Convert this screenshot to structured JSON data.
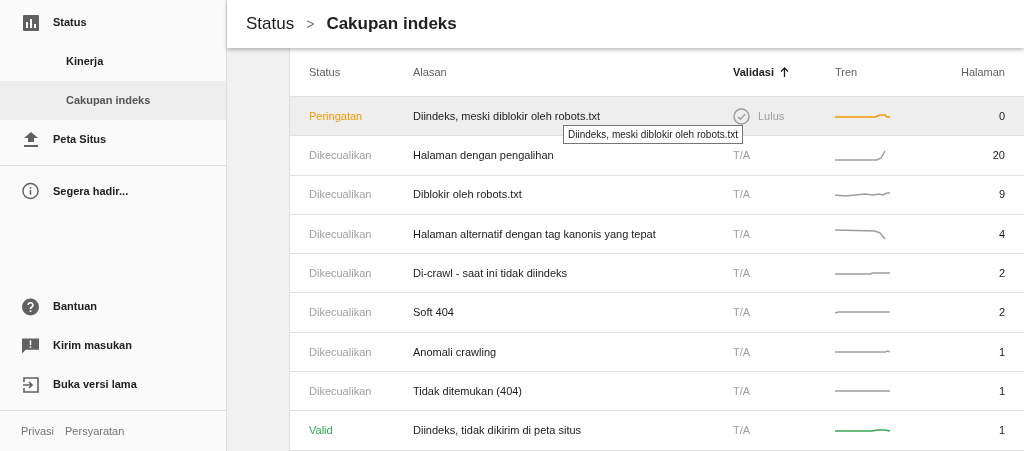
{
  "sidebar": {
    "items": [
      {
        "label": "Status",
        "selected": false,
        "children": [
          {
            "label": "Kinerja",
            "selected": false
          },
          {
            "label": "Cakupan indeks",
            "selected": true
          }
        ]
      },
      {
        "label": "Peta Situs",
        "selected": false
      }
    ],
    "soon": {
      "label": "Segera hadir..."
    },
    "bottom_items": [
      {
        "label": "Bantuan"
      },
      {
        "label": "Kirim masukan"
      },
      {
        "label": "Buka versi lama"
      }
    ],
    "footer_links": [
      "Privasi",
      "Persyaratan"
    ]
  },
  "breadcrumb": {
    "parent": "Status",
    "separator": ">",
    "current": "Cakupan indeks"
  },
  "table": {
    "columns": [
      {
        "label": "Status",
        "sorted": false
      },
      {
        "label": "Alasan",
        "sorted": false
      },
      {
        "label": "Validasi",
        "sorted": true
      },
      {
        "label": "Tren",
        "sorted": false
      },
      {
        "label": "Halaman",
        "sorted": false
      }
    ],
    "rows": [
      {
        "status": "Peringatan",
        "kind": "warning",
        "reason": "Diindeks, meski diblokir oleh robots.txt",
        "validation": "Lulus",
        "passed": true,
        "pages": "0",
        "selected": true
      },
      {
        "status": "Dikecualikan",
        "kind": "excluded",
        "reason": "Halaman dengan pengalihan",
        "validation": "T/A",
        "passed": false,
        "pages": "20",
        "selected": false
      },
      {
        "status": "Dikecualikan",
        "kind": "excluded",
        "reason": "Diblokir oleh robots.txt",
        "validation": "T/A",
        "passed": false,
        "pages": "9",
        "selected": false
      },
      {
        "status": "Dikecualikan",
        "kind": "excluded",
        "reason": "Halaman alternatif dengan tag kanonis yang tepat",
        "validation": "T/A",
        "passed": false,
        "pages": "4",
        "selected": false
      },
      {
        "status": "Dikecualikan",
        "kind": "excluded",
        "reason": "Di-crawl - saat ini tidak diindeks",
        "validation": "T/A",
        "passed": false,
        "pages": "2",
        "selected": false
      },
      {
        "status": "Dikecualikan",
        "kind": "excluded",
        "reason": "Soft 404",
        "validation": "T/A",
        "passed": false,
        "pages": "2",
        "selected": false
      },
      {
        "status": "Dikecualikan",
        "kind": "excluded",
        "reason": "Anomali crawling",
        "validation": "T/A",
        "passed": false,
        "pages": "1",
        "selected": false
      },
      {
        "status": "Dikecualikan",
        "kind": "excluded",
        "reason": "Tidak ditemukan (404)",
        "validation": "T/A",
        "passed": false,
        "pages": "1",
        "selected": false
      },
      {
        "status": "Valid",
        "kind": "valid",
        "reason": "Diindeks, tidak dikirim di peta situs",
        "validation": "T/A",
        "passed": false,
        "pages": "1",
        "selected": false
      }
    ]
  },
  "tooltip": "Diindeks, meski diblokir oleh robots.txt"
}
